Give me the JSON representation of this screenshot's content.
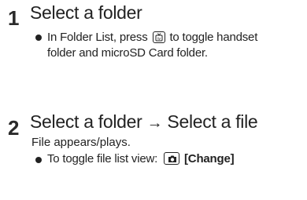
{
  "steps": [
    {
      "number": "1",
      "title": "Select a folder",
      "bullet": {
        "line1_before": "In Folder List, press",
        "key_icon": "tv-key-icon",
        "line1_after": "to toggle handset",
        "line2": "folder and microSD Card folder."
      }
    },
    {
      "number": "2",
      "title_part1": "Select a folder",
      "arrow": "→",
      "title_part2": "Select a file",
      "note": "File appears/plays.",
      "bullet": {
        "text_before": "To toggle file list view:",
        "key_icon": "camera-key-icon",
        "key_label": "[Change]"
      }
    }
  ]
}
